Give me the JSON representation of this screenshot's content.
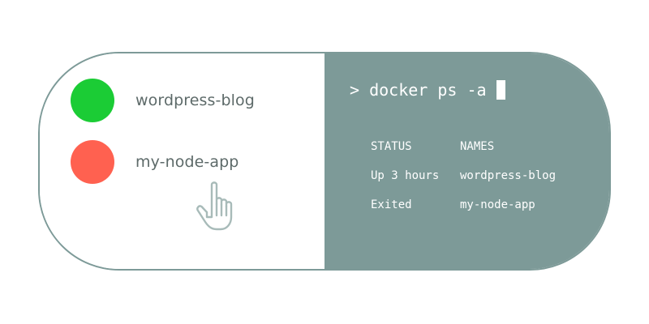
{
  "containers": [
    {
      "name": "wordpress-blog",
      "status_color": "#1bcc35",
      "state": "running"
    },
    {
      "name": "my-node-app",
      "status_color": "#ff6150",
      "state": "exited"
    }
  ],
  "terminal": {
    "prompt": "> docker ps -a",
    "table": {
      "headers": {
        "status": "STATUS",
        "names": "NAMES"
      },
      "rows": [
        {
          "status": "Up 3 hours",
          "names": "wordpress-blog"
        },
        {
          "status": "Exited",
          "names": "my-node-app"
        }
      ]
    }
  },
  "icons": {
    "pointer": "hand-pointer-icon"
  },
  "colors": {
    "accent": "#7d9a98",
    "running": "#1bcc35",
    "exited": "#ff6150",
    "text": "#5d6a69"
  }
}
